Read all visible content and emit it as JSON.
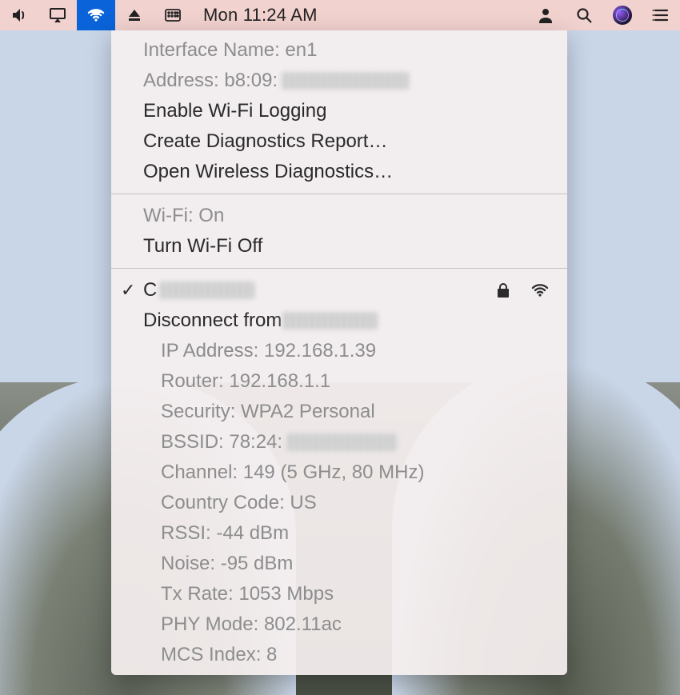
{
  "menubar": {
    "clock": "Mon 11:24 AM"
  },
  "menu": {
    "interface_name": "Interface Name: en1",
    "address_prefix": "Address: b8:09:",
    "enable_logging": "Enable Wi-Fi Logging",
    "create_diag": "Create Diagnostics Report…",
    "open_diag": "Open Wireless Diagnostics…",
    "wifi_status": "Wi-Fi: On",
    "toggle_wifi": "Turn Wi-Fi Off",
    "current_network_prefix": "C",
    "disconnect_prefix": "Disconnect from ",
    "details": {
      "ip": "IP Address: 192.168.1.39",
      "router": "Router: 192.168.1.1",
      "security": "Security: WPA2 Personal",
      "bssid_prefix": "BSSID: 78:24:",
      "channel": "Channel: 149 (5 GHz, 80 MHz)",
      "country": "Country Code: US",
      "rssi": "RSSI: -44 dBm",
      "noise": "Noise: -95 dBm",
      "tx": "Tx Rate: 1053 Mbps",
      "phy": "PHY Mode: 802.11ac",
      "mcs": "MCS Index: 8"
    }
  }
}
